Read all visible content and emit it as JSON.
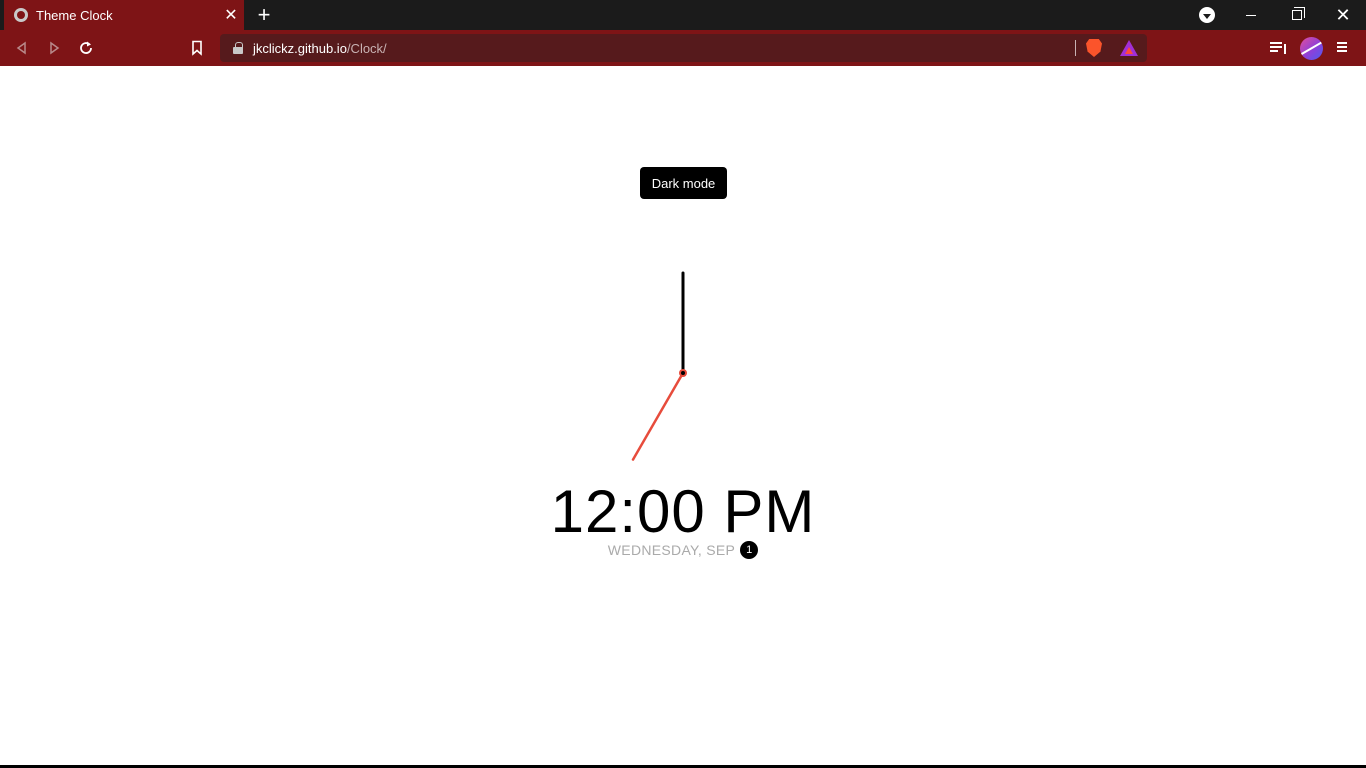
{
  "browser": {
    "tab_title": "Theme Clock",
    "tab_close": "✕",
    "new_tab": "+",
    "url_host": "jkclickz.github.io",
    "url_path": "/Clock/",
    "window_close": "✕",
    "icons": [
      "globe-icon",
      "back-icon",
      "forward-icon",
      "reload-icon",
      "bookmark-icon",
      "lock-icon",
      "brave-shields-icon",
      "brave-rewards-icon",
      "media-queue-icon",
      "avatar",
      "menu-icon"
    ]
  },
  "page": {
    "toggle_label": "Dark mode",
    "time": "12:00 PM",
    "date_text": "WEDNESDAY, SEP",
    "date_day": "1"
  },
  "colors": {
    "chrome_dark": "#1b1b1b",
    "chrome_red": "#7e1416",
    "urlbar": "#561a1c",
    "second_hand": "#e74c3c",
    "text": "#000000",
    "date_text": "#aaaaaa"
  },
  "clock": {
    "hour_hand_angle_deg": 0,
    "minute_hand_angle_deg": 0,
    "second_hand_angle_deg": 210
  }
}
